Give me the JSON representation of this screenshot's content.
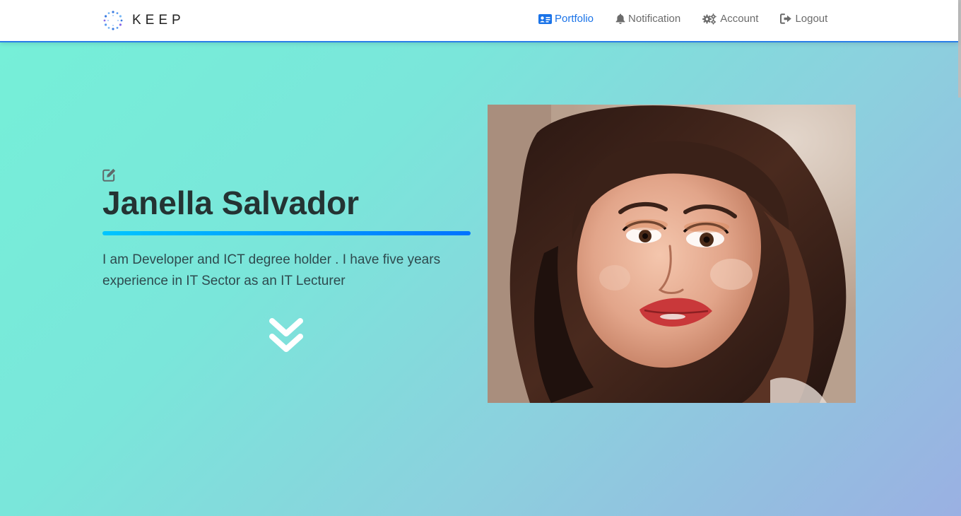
{
  "brand": {
    "name": "KEEP",
    "logo_icon": "circle-of-dots-logo"
  },
  "nav": {
    "items": [
      {
        "label": "Portfolio",
        "icon": "id-card-icon",
        "active": true
      },
      {
        "label": "Notification",
        "icon": "bell-icon",
        "active": false
      },
      {
        "label": "Account",
        "icon": "gears-icon",
        "active": false
      },
      {
        "label": "Logout",
        "icon": "sign-out-icon",
        "active": false
      }
    ]
  },
  "profile": {
    "name": "Janella Salvador",
    "bio": "I am Developer and ICT degree holder . I have five years experience in IT Sector as an IT Lecturer",
    "edit_icon": "edit-icon",
    "scroll_icon": "double-chevron-down-icon",
    "photo": "profile-photo"
  },
  "colors": {
    "accent": "#1a73e8",
    "nav_text": "#6b6b6b",
    "gradient_start": "#75f0d8",
    "gradient_end": "#9ab0e2",
    "underline_start": "#00c6ff",
    "underline_end": "#0072ff",
    "heading": "#243333"
  }
}
